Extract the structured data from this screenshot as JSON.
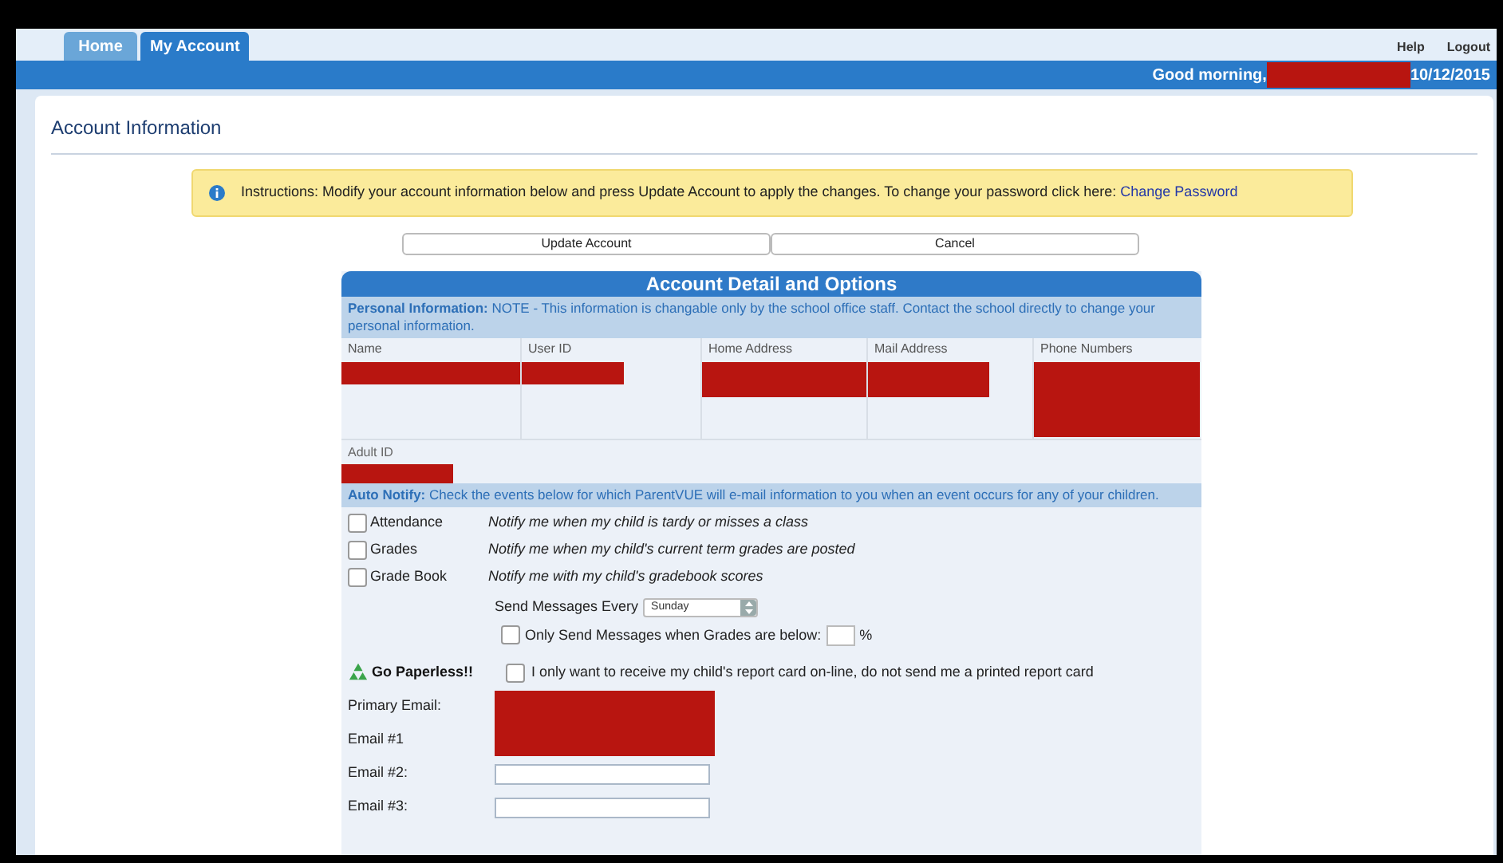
{
  "tabs": [
    {
      "label": "Home",
      "selected": false
    },
    {
      "label": "My Account",
      "selected": true
    }
  ],
  "top_links": [
    "Help",
    "Logout"
  ],
  "greeting": "Good morning,",
  "date": "10/12/2015",
  "page_title": "Account Information",
  "instructions": {
    "text": "Instructions: Modify your account information below and press Update Account to apply the changes. To change your password click here:",
    "link": "Change Password"
  },
  "buttons": [
    "Update Account",
    "Cancel"
  ],
  "panel_title": "Account Detail and Options",
  "personal_info": {
    "heading": "Personal Information:",
    "note": "NOTE - This information is changable only by the school office staff. Contact the school directly to change your personal information."
  },
  "columns": [
    "Name",
    "User ID",
    "Home Address",
    "Mail Address",
    "Phone Numbers"
  ],
  "adult_id_label": "Adult ID",
  "auto_notify": {
    "heading": "Auto Notify:",
    "note": "Check the events below for which ParentVUE will e-mail information to you when an event occurs for any of your children."
  },
  "notify_options": [
    {
      "label": "Attendance",
      "description": "Notify me when my child is tardy or misses a class",
      "checked": false
    },
    {
      "label": "Grades",
      "description": "Notify me when my child's current term grades are posted",
      "checked": false
    },
    {
      "label": "Grade Book",
      "description": "Notify me with my child's gradebook scores",
      "checked": false
    }
  ],
  "send_every": {
    "label": "Send Messages Every",
    "value": "Sunday"
  },
  "grade_threshold": {
    "label": "Only Send Messages when Grades are below:",
    "checked": false,
    "unit": "%"
  },
  "paperless": {
    "label": "Go Paperless!!",
    "option": "I only want to receive my child's report card on-line, do not send me a printed report card",
    "checked": false
  },
  "emails": [
    {
      "label": "Primary Email:"
    },
    {
      "label": "Email #1"
    },
    {
      "label": "Email #2:"
    },
    {
      "label": "Email #3:"
    }
  ]
}
